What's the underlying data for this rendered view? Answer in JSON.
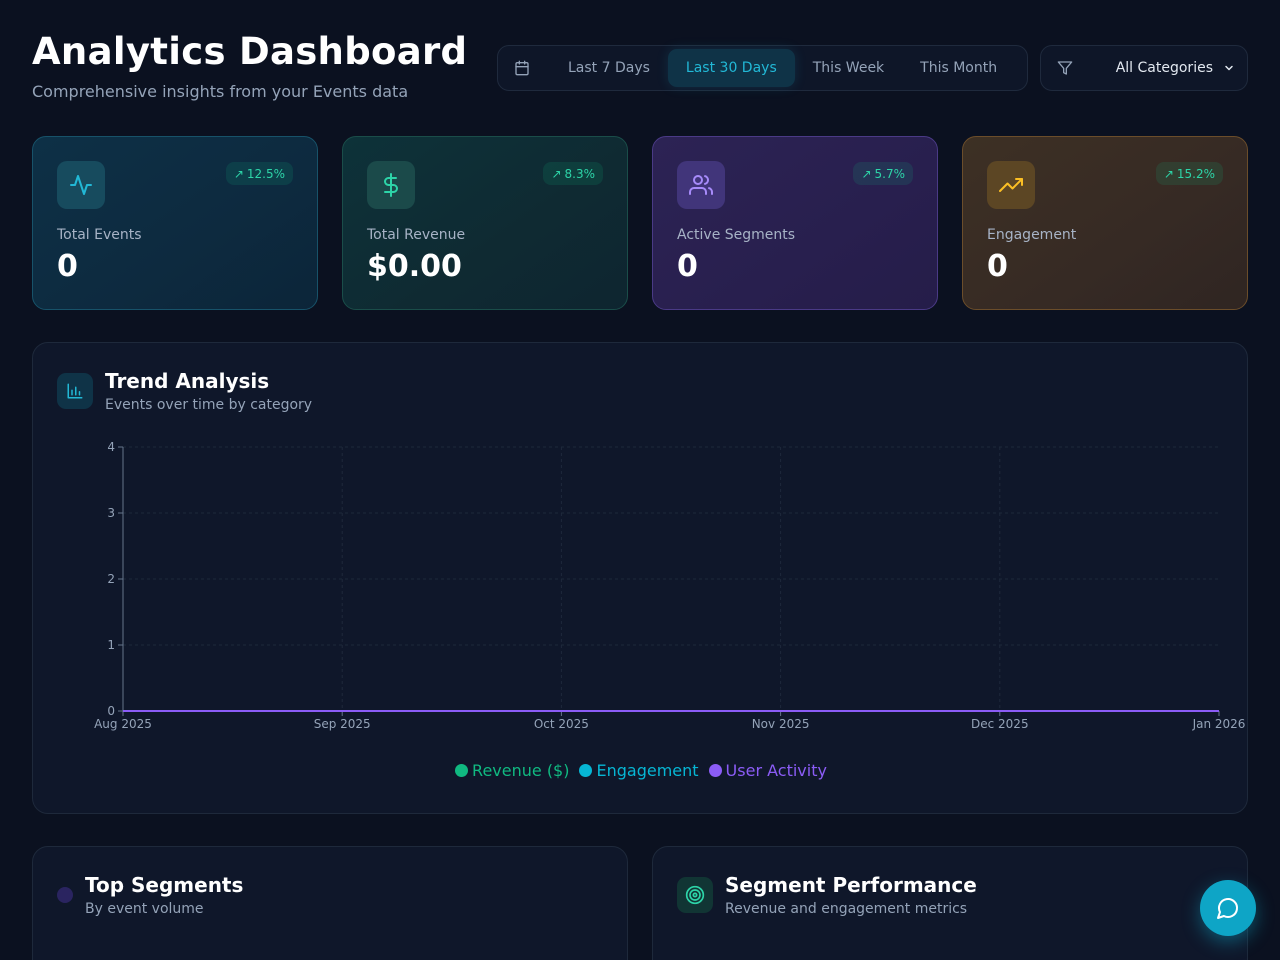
{
  "header": {
    "title": "Analytics Dashboard",
    "subtitle": "Comprehensive insights from your Events data"
  },
  "date_ranges": [
    {
      "label": "Last 7 Days",
      "active": false
    },
    {
      "label": "Last 30 Days",
      "active": true
    },
    {
      "label": "This Week",
      "active": false
    },
    {
      "label": "This Month",
      "active": false
    }
  ],
  "category_filter": {
    "selected": "All Categories"
  },
  "stats": [
    {
      "label": "Total Events",
      "value": "0",
      "change": "12.5%",
      "icon": "activity-icon",
      "accent": "#22b8d6"
    },
    {
      "label": "Total Revenue",
      "value": "$0.00",
      "change": "8.3%",
      "icon": "dollar-icon",
      "accent": "#2dd4a8"
    },
    {
      "label": "Active Segments",
      "value": "0",
      "change": "5.7%",
      "icon": "users-icon",
      "accent": "#a78bfa"
    },
    {
      "label": "Engagement",
      "value": "0",
      "change": "15.2%",
      "icon": "trending-up-icon",
      "accent": "#fbbf24"
    }
  ],
  "trend": {
    "title": "Trend Analysis",
    "subtitle": "Events over time by category"
  },
  "chart_data": {
    "type": "line",
    "x": [
      "Aug 2025",
      "Sep 2025",
      "Oct 2025",
      "Nov 2025",
      "Dec 2025",
      "Jan 2026"
    ],
    "yticks": [
      "0",
      "1",
      "2",
      "3",
      "4"
    ],
    "ylim": [
      0,
      4
    ],
    "grid": true,
    "legend": "bottom-center",
    "series": [
      {
        "name": "Revenue ($)",
        "color": "#10b981",
        "values": [
          0,
          0,
          0,
          0,
          0,
          0
        ]
      },
      {
        "name": "Engagement",
        "color": "#06b6d4",
        "values": [
          0,
          0,
          0,
          0,
          0,
          0
        ]
      },
      {
        "name": "User Activity",
        "color": "#8b5cf6",
        "values": [
          0,
          0,
          0,
          0,
          0,
          0
        ]
      }
    ]
  },
  "top_segments": {
    "title": "Top Segments",
    "subtitle": "By event volume"
  },
  "segment_performance": {
    "title": "Segment Performance",
    "subtitle": "Revenue and engagement metrics"
  }
}
